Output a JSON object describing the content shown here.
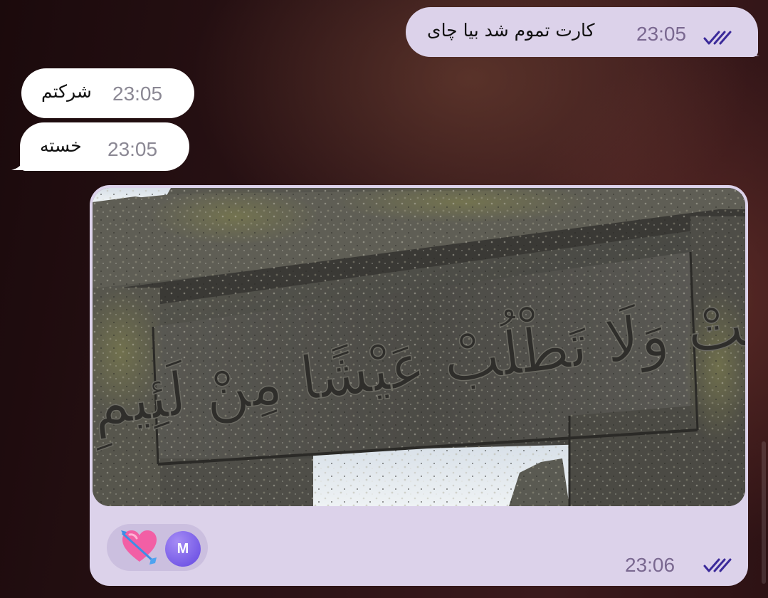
{
  "messages": [
    {
      "direction": "outgoing",
      "text": "کارت تموم شد بیا چای",
      "time": "23:05",
      "status": "read",
      "status_icon": "double-check-icon"
    },
    {
      "direction": "incoming",
      "text": "شرکتم",
      "time": "23:05"
    },
    {
      "direction": "incoming",
      "text": "خسته",
      "time": "23:05"
    },
    {
      "direction": "outgoing",
      "type": "photo",
      "photo_inscription": "مُتْ وَلَا تَطْلُبْ عَيْشًا مِنْ لَئِيمِ",
      "time": "23:06",
      "status": "read",
      "status_icon": "double-check-icon",
      "reaction": {
        "emoji": "💘",
        "icon": "heart-with-arrow-icon",
        "user_initial": "M"
      }
    }
  ],
  "colors": {
    "outgoing_bubble": "#dcd2ea",
    "incoming_bubble": "#ffffff",
    "check_color": "#3b2a9a",
    "avatar": "#7a5cf0"
  }
}
